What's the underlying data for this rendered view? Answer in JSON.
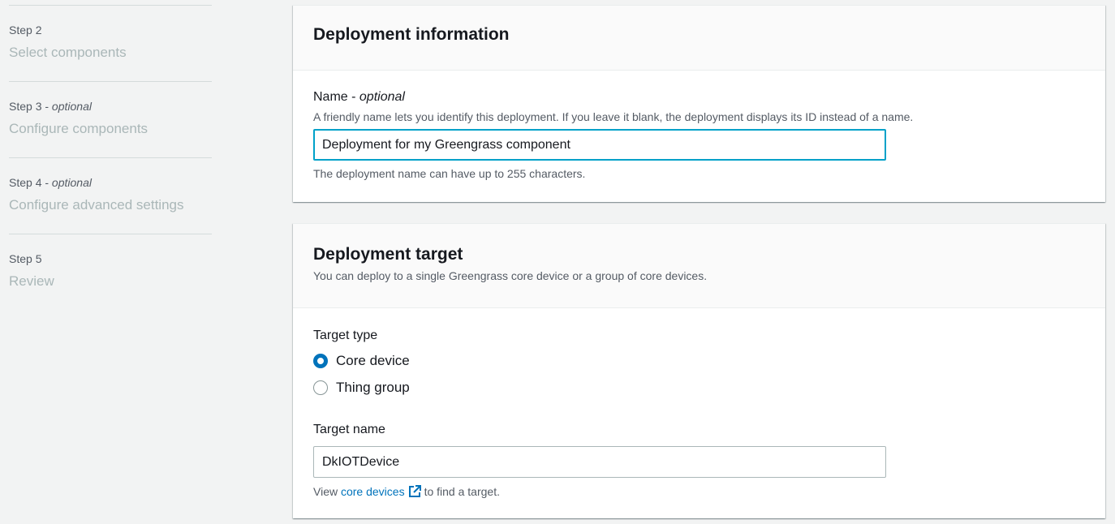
{
  "steps": [
    {
      "label": "Step 2",
      "optional": "",
      "title": "Select components"
    },
    {
      "label": "Step 3 - ",
      "optional": "optional",
      "title": "Configure components"
    },
    {
      "label": "Step 4 - ",
      "optional": "optional",
      "title": "Configure advanced settings"
    },
    {
      "label": "Step 5",
      "optional": "",
      "title": "Review"
    }
  ],
  "deployment_info": {
    "title": "Deployment information",
    "name_label": "Name - ",
    "name_optional": "optional",
    "name_desc": "A friendly name lets you identify this deployment. If you leave it blank, the deployment displays its ID instead of a name.",
    "name_value": "Deployment for my Greengrass component",
    "name_constraint": "The deployment name can have up to 255 characters."
  },
  "deployment_target": {
    "title": "Deployment target",
    "desc": "You can deploy to a single Greengrass core device or a group of core devices.",
    "target_type_label": "Target type",
    "options": [
      {
        "label": "Core device",
        "checked": true
      },
      {
        "label": "Thing group",
        "checked": false
      }
    ],
    "target_name_label": "Target name",
    "target_name_value": "DkIOTDevice",
    "help_prefix": "View ",
    "help_link": "core devices",
    "help_suffix": "to find a target."
  },
  "colors": {
    "accent": "#0073bb",
    "focus": "#00a1c9"
  },
  "icons": {
    "external_link": "external-link-icon"
  }
}
